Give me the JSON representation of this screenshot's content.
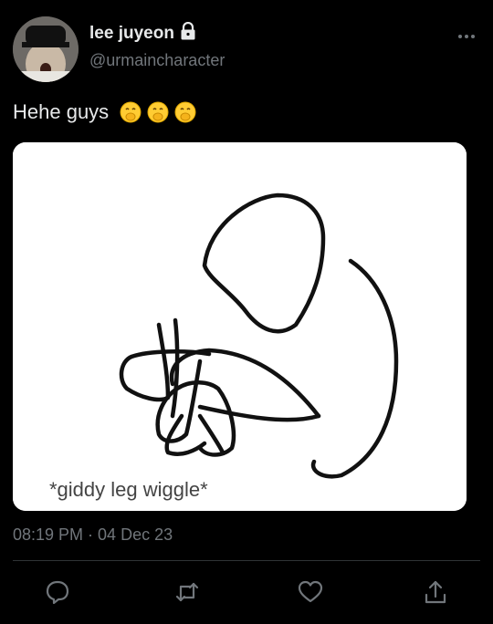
{
  "user": {
    "display_name": "lee juyeon",
    "handle": "@urmaincharacter",
    "avatar_icon": "user-photo",
    "verified_icon": "lock-icon"
  },
  "tweet": {
    "text": "Hehe guys",
    "emoji_icons": [
      "face-with-hand-over-mouth",
      "face-with-hand-over-mouth",
      "face-with-hand-over-mouth"
    ],
    "media_caption": "*giddy leg wiggle*",
    "timestamp": "08:19 PM · 04 Dec 23"
  },
  "actions": [
    "reply-icon",
    "retweet-icon",
    "like-icon",
    "share-icon"
  ],
  "colors": {
    "background": "#000000",
    "text": "#e7e9ea",
    "muted": "#71767b",
    "divider": "#2f3336"
  }
}
